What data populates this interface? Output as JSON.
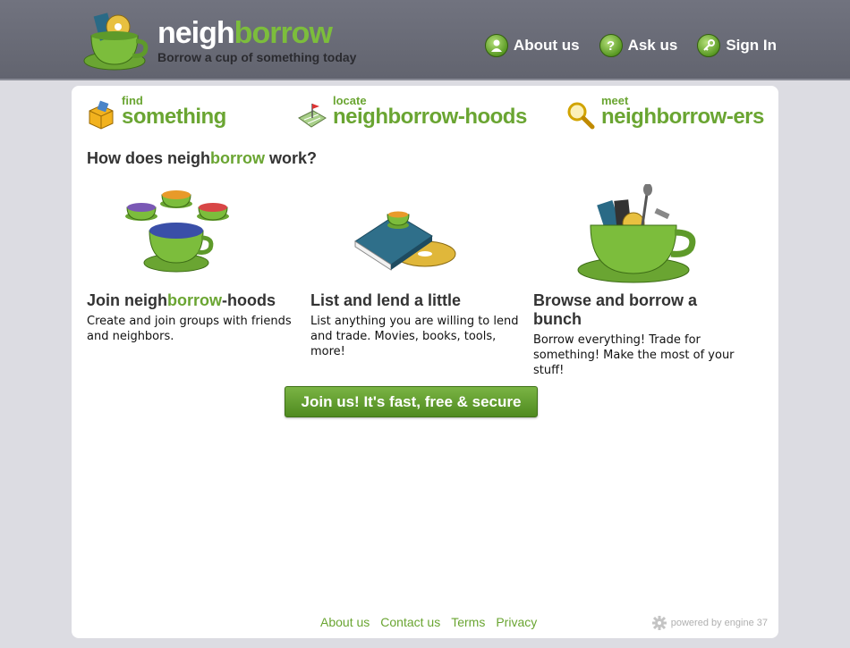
{
  "brand": {
    "name_part1": "neigh",
    "name_part2": "borrow",
    "tagline": "Borrow a cup of something today"
  },
  "nav": [
    {
      "label": "About us",
      "icon": "person-icon",
      "glyph": "●"
    },
    {
      "label": "Ask us",
      "icon": "question-icon",
      "glyph": "?"
    },
    {
      "label": "Sign In",
      "icon": "key-icon",
      "glyph": "⚷"
    }
  ],
  "tabs": [
    {
      "small": "find",
      "big": "something",
      "icon": "box-icon"
    },
    {
      "small": "locate",
      "big": "neighborrow-hoods",
      "icon": "map-icon"
    },
    {
      "small": "meet",
      "big": "neighborrow-ers",
      "icon": "magnifier-icon"
    }
  ],
  "how": {
    "pre": "How does neigh",
    "green": "borrow",
    "post": " work?"
  },
  "columns": [
    {
      "title_pre": "Join neigh",
      "title_green": "borrow",
      "title_post": "-hoods",
      "desc": "Create and join groups with friends and neighbors."
    },
    {
      "title_pre": "List and lend a little",
      "title_green": "",
      "title_post": "",
      "desc": "List anything you are willing to lend and trade. Movies, books, tools, more!"
    },
    {
      "title_pre": "Browse and borrow a bunch",
      "title_green": "",
      "title_post": "",
      "desc": "Borrow everything! Trade for something! Make the most of your stuff!"
    }
  ],
  "cta": {
    "label": "Join us! It's fast, free & secure"
  },
  "footer": {
    "links": [
      "About us",
      "Contact us",
      "Terms",
      "Privacy"
    ],
    "powered": "powered by engine 37"
  },
  "colors": {
    "green": "#6aa532",
    "header": "#6a6c77",
    "background": "#dcdce2"
  }
}
